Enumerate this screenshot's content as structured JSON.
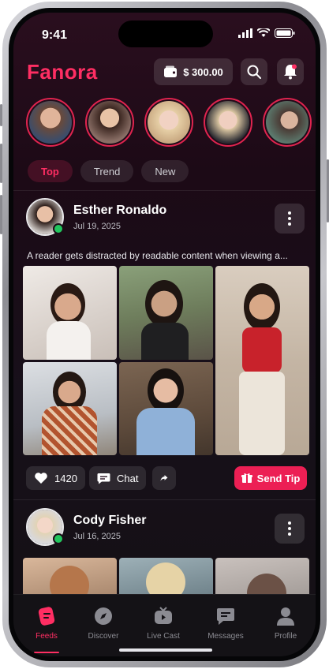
{
  "status": {
    "time": "9:41"
  },
  "app": {
    "brand": "Fanora",
    "accent": "#ff2e63"
  },
  "header": {
    "balance": "$ 300.00",
    "wallet_icon": "wallet-icon",
    "search_icon": "search-icon",
    "notification_icon": "bell-icon"
  },
  "tabs": [
    {
      "label": "Top",
      "active": true
    },
    {
      "label": "Trend"
    },
    {
      "label": "New"
    }
  ],
  "posts": [
    {
      "name": "Esther Ronaldo",
      "date": "Jul 19, 2025",
      "online": true,
      "caption": "A reader gets distracted by readable content when viewing a...",
      "likes": "1420",
      "chat_label": "Chat",
      "tip_label": "Send Tip"
    },
    {
      "name": "Cody Fisher",
      "date": "Jul 16, 2025",
      "online": true
    }
  ],
  "nav": [
    {
      "label": "Feeds",
      "icon": "feeds-icon",
      "active": true
    },
    {
      "label": "Discover",
      "icon": "compass-icon"
    },
    {
      "label": "Live Cast",
      "icon": "live-tv-icon"
    },
    {
      "label": "Messages",
      "icon": "message-icon"
    },
    {
      "label": "Profile",
      "icon": "profile-icon"
    }
  ]
}
